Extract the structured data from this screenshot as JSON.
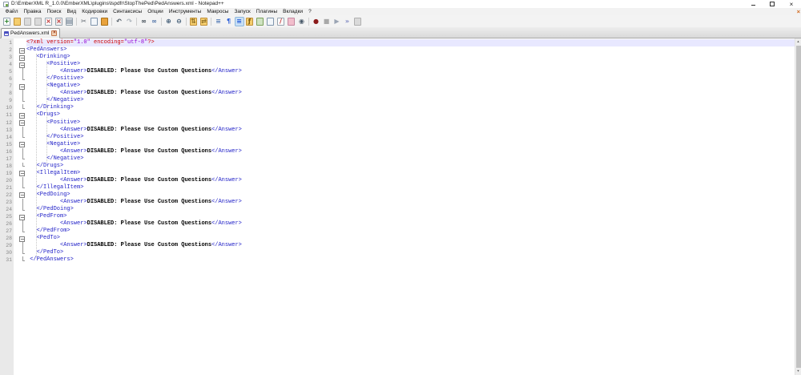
{
  "window": {
    "title": "D:\\EmberXML R_1.0.0\\EmberXML\\plugins\\lspdfr\\StopThePed\\PedAnswers.xml - Notepad++",
    "controls": {
      "minimize": "minimize",
      "restore": "restore",
      "close": "close"
    }
  },
  "menu": {
    "items": [
      {
        "id": "file",
        "label": "Файл"
      },
      {
        "id": "edit",
        "label": "Правка"
      },
      {
        "id": "search",
        "label": "Поиск"
      },
      {
        "id": "view",
        "label": "Вид"
      },
      {
        "id": "encoding",
        "label": "Кодировки"
      },
      {
        "id": "language",
        "label": "Синтаксисы"
      },
      {
        "id": "settings",
        "label": "Опции"
      },
      {
        "id": "tools",
        "label": "Инструменты"
      },
      {
        "id": "macro",
        "label": "Макросы"
      },
      {
        "id": "run",
        "label": "Запуск"
      },
      {
        "id": "plugins",
        "label": "Плагины"
      },
      {
        "id": "tabs",
        "label": "Вкладки"
      },
      {
        "id": "help",
        "label": "?"
      }
    ],
    "close_glyph": "×"
  },
  "toolbar": {
    "groups": [
      [
        {
          "n": "new-file",
          "g": "+",
          "gc": "#1E7A1E",
          "bg": "#FDFDFD",
          "bc": "#96A4B0"
        },
        {
          "n": "open-file",
          "bg": "#F5CE6E",
          "bc": "#C09038"
        },
        {
          "n": "save-file",
          "bg": "#DADADA",
          "bc": "#AFAFAF"
        },
        {
          "n": "save-all",
          "bg": "#DADADA",
          "bc": "#AFAFAF"
        },
        {
          "n": "close-file",
          "g": "×",
          "gc": "#C03030",
          "bg": "#FDFDFD",
          "bc": "#96A4B0"
        },
        {
          "n": "close-all",
          "g": "×",
          "gc": "#C03030",
          "bg": "#EFEFEF",
          "bc": "#96A4B0"
        },
        {
          "n": "print",
          "g": "▤",
          "gc": "#68788A",
          "bg": "#E9EDF0",
          "bc": "#93A0AA"
        }
      ],
      [
        {
          "n": "cut",
          "g": "✂",
          "gc": "#606870"
        },
        {
          "n": "copy",
          "bg": "#F2F6FA",
          "bc": "#7E94AC"
        },
        {
          "n": "paste",
          "bg": "#E8A23C",
          "bc": "#A87018"
        }
      ],
      [
        {
          "n": "undo",
          "g": "↶",
          "gc": "#4A5560"
        },
        {
          "n": "redo",
          "g": "↷",
          "gc": "#A8B0B8"
        }
      ],
      [
        {
          "n": "find",
          "g": "∞",
          "gc": "#3A4550"
        },
        {
          "n": "replace",
          "g": "∞",
          "gc": "#4A6FA5"
        }
      ],
      [
        {
          "n": "zoom-in",
          "g": "⊕",
          "gc": "#3A5570"
        },
        {
          "n": "zoom-out",
          "g": "⊖",
          "gc": "#3A5570"
        }
      ],
      [
        {
          "n": "sync-vertical-scroll",
          "g": "⇅",
          "gc": "#8A6A20",
          "bg": "#F5CE6E",
          "bc": "#C09038"
        },
        {
          "n": "sync-horizontal-scroll",
          "g": "⇄",
          "gc": "#8A6A20",
          "bg": "#F5CE6E",
          "bc": "#C09038"
        }
      ],
      [
        {
          "n": "word-wrap",
          "g": "≡",
          "gc": "#5A80B8"
        },
        {
          "n": "show-all-characters",
          "g": "¶",
          "gc": "#2B5FD9"
        },
        {
          "n": "show-indent-guide",
          "g": "≡",
          "gc": "#2B5FD9",
          "pressed": true
        },
        {
          "n": "function-list",
          "g": "ƒ",
          "gc": "#7A5A10",
          "bg": "#F5CE6E",
          "bc": "#C09038"
        },
        {
          "n": "document-map",
          "bg": "#CFE3C2",
          "bc": "#7BA05B"
        },
        {
          "n": "document-list",
          "bg": "#F2F6FA",
          "bc": "#7E94AC"
        },
        {
          "n": "folder-as-workspace",
          "g": "/",
          "gc": "#C03030",
          "bg": "#FDFDFD",
          "bc": "#96A4B0"
        },
        {
          "n": "plugin-tool",
          "bg": "#F2BECC",
          "bc": "#C488A0"
        },
        {
          "n": "monitoring",
          "g": "◉",
          "gc": "#4A5A6A"
        }
      ],
      [
        {
          "n": "macro-record",
          "g": "●",
          "gc": "#8B1A1A"
        },
        {
          "n": "macro-stop",
          "g": "■",
          "gc": "#A8A8A8"
        },
        {
          "n": "macro-play",
          "g": "▶",
          "gc": "#9AA4B4"
        },
        {
          "n": "macro-run-multiple",
          "g": "»",
          "gc": "#7A84C0"
        },
        {
          "n": "macro-save",
          "bg": "#DADADA",
          "bc": "#AFAFAF"
        }
      ]
    ]
  },
  "tabbar": {
    "tabs": [
      {
        "label": "PedAnswers.xml",
        "active": true,
        "saved": true,
        "close_glyph": "×"
      }
    ]
  },
  "editor": {
    "style": {
      "t": {
        "color": "#2222C8"
      },
      "c": {
        "color": "#000000",
        "bold": true
      },
      "r": {
        "color": "#CE0000"
      },
      "v": {
        "color": "#9400D3"
      }
    },
    "colors": {
      "current_line_bg": "#E8E8FF",
      "gutter_bg": "#E9E9E9",
      "line_number": "#8A8A8A"
    },
    "lines": [
      {
        "n": 1,
        "f": "n",
        "cur": true,
        "s": [
          [
            "r",
            "<?xml version="
          ],
          [
            "v",
            "\"1.0\""
          ],
          [
            "r",
            " encoding="
          ],
          [
            "v",
            "\"utf-8\""
          ],
          [
            "r",
            "?>"
          ]
        ]
      },
      {
        "n": 2,
        "f": "o",
        "s": [
          [
            "t",
            "<PedAnswers>"
          ]
        ]
      },
      {
        "n": 3,
        "f": "o",
        "s": [
          [
            "t",
            "   <Drinking>"
          ]
        ]
      },
      {
        "n": 4,
        "f": "o",
        "s": [
          [
            "t",
            "      <Positive>"
          ]
        ]
      },
      {
        "n": 5,
        "f": "m",
        "s": [
          [
            "t",
            "          <Answer>"
          ],
          [
            "c",
            "DISABLED: Please Use Custom Questions"
          ],
          [
            "t",
            "</Answer>"
          ]
        ]
      },
      {
        "n": 6,
        "f": "e",
        "s": [
          [
            "t",
            "      </Positive>"
          ]
        ]
      },
      {
        "n": 7,
        "f": "o",
        "s": [
          [
            "t",
            "      <Negative>"
          ]
        ]
      },
      {
        "n": 8,
        "f": "m",
        "s": [
          [
            "t",
            "          <Answer>"
          ],
          [
            "c",
            "DISABLED: Please Use Custom Questions"
          ],
          [
            "t",
            "</Answer>"
          ]
        ]
      },
      {
        "n": 9,
        "f": "e",
        "s": [
          [
            "t",
            "      </Negative>"
          ]
        ]
      },
      {
        "n": 10,
        "f": "e",
        "s": [
          [
            "t",
            "   </Drinking>"
          ]
        ]
      },
      {
        "n": 11,
        "f": "o",
        "s": [
          [
            "t",
            "   <Drugs>"
          ]
        ]
      },
      {
        "n": 12,
        "f": "o",
        "s": [
          [
            "t",
            "      <Positive>"
          ]
        ]
      },
      {
        "n": 13,
        "f": "m",
        "s": [
          [
            "t",
            "          <Answer>"
          ],
          [
            "c",
            "DISABLED: Please Use Custom Questions"
          ],
          [
            "t",
            "</Answer>"
          ]
        ]
      },
      {
        "n": 14,
        "f": "e",
        "s": [
          [
            "t",
            "      </Positive>"
          ]
        ]
      },
      {
        "n": 15,
        "f": "o",
        "s": [
          [
            "t",
            "      <Negative>"
          ]
        ]
      },
      {
        "n": 16,
        "f": "m",
        "s": [
          [
            "t",
            "          <Answer>"
          ],
          [
            "c",
            "DISABLED: Please Use Custom Questions"
          ],
          [
            "t",
            "</Answer>"
          ]
        ]
      },
      {
        "n": 17,
        "f": "e",
        "s": [
          [
            "t",
            "      </Negative>"
          ]
        ]
      },
      {
        "n": 18,
        "f": "e",
        "s": [
          [
            "t",
            "   </Drugs>"
          ]
        ]
      },
      {
        "n": 19,
        "f": "o",
        "s": [
          [
            "t",
            "   <IllegalItem>"
          ]
        ]
      },
      {
        "n": 20,
        "f": "m",
        "s": [
          [
            "t",
            "          <Answer>"
          ],
          [
            "c",
            "DISABLED: Please Use Custom Questions"
          ],
          [
            "t",
            "</Answer>"
          ]
        ]
      },
      {
        "n": 21,
        "f": "e",
        "s": [
          [
            "t",
            "   </IllegalItem>"
          ]
        ]
      },
      {
        "n": 22,
        "f": "o",
        "s": [
          [
            "t",
            "   <PedDoing>"
          ]
        ]
      },
      {
        "n": 23,
        "f": "m",
        "s": [
          [
            "t",
            "          <Answer>"
          ],
          [
            "c",
            "DISABLED: Please Use Custom Questions"
          ],
          [
            "t",
            "</Answer>"
          ]
        ]
      },
      {
        "n": 24,
        "f": "e",
        "s": [
          [
            "t",
            "   </PedDoing>"
          ]
        ]
      },
      {
        "n": 25,
        "f": "o",
        "s": [
          [
            "t",
            "   <PedFrom>"
          ]
        ]
      },
      {
        "n": 26,
        "f": "m",
        "s": [
          [
            "t",
            "          <Answer>"
          ],
          [
            "c",
            "DISABLED: Please Use Custom Questions"
          ],
          [
            "t",
            "</Answer>"
          ]
        ]
      },
      {
        "n": 27,
        "f": "e",
        "s": [
          [
            "t",
            "   </PedFrom>"
          ]
        ]
      },
      {
        "n": 28,
        "f": "o",
        "s": [
          [
            "t",
            "   <PedTo>"
          ]
        ]
      },
      {
        "n": 29,
        "f": "m",
        "s": [
          [
            "t",
            "          <Answer>"
          ],
          [
            "c",
            "DISABLED: Please Use Custom Questions"
          ],
          [
            "t",
            "</Answer>"
          ]
        ]
      },
      {
        "n": 30,
        "f": "e",
        "s": [
          [
            "t",
            "   </PedTo>"
          ]
        ]
      },
      {
        "n": 31,
        "f": "e",
        "s": [
          [
            "t",
            " </PedAnswers>"
          ]
        ]
      }
    ]
  }
}
